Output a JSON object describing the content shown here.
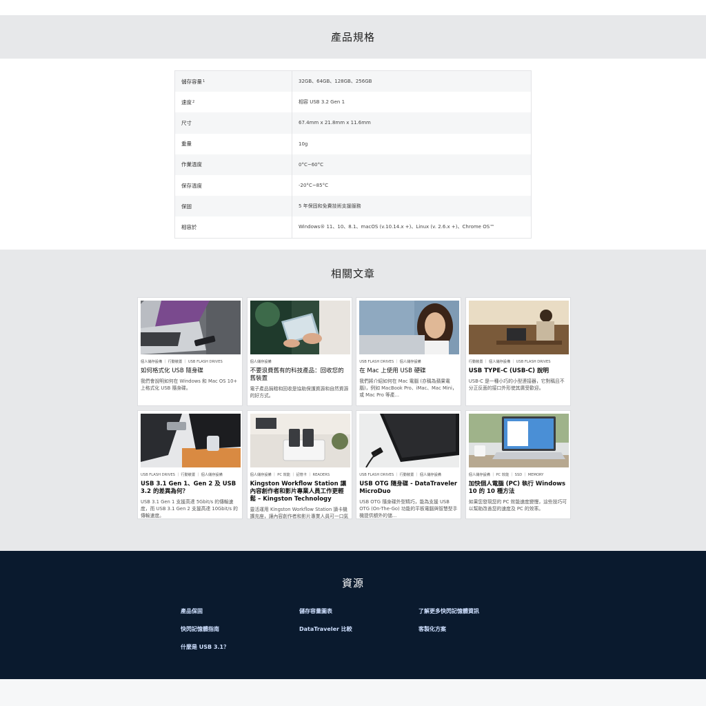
{
  "spec": {
    "title": "產品規格",
    "rows": [
      {
        "label": "儲存容量",
        "sup": "1",
        "value": "32GB、64GB、128GB、256GB"
      },
      {
        "label": "速度",
        "sup": "2",
        "value": "相容 USB 3.2 Gen 1"
      },
      {
        "label": "尺寸",
        "sup": "",
        "value": "67.4mm x 21.8mm x 11.6mm"
      },
      {
        "label": "重量",
        "sup": "",
        "value": "10g"
      },
      {
        "label": "作業溫度",
        "sup": "",
        "value": "0°C~60°C"
      },
      {
        "label": "保存溫度",
        "sup": "",
        "value": "-20°C~85°C"
      },
      {
        "label": "保固",
        "sup": "",
        "value": "5 年保固和免費技術支援服務"
      },
      {
        "label": "相容於",
        "sup": "",
        "value": "Windows® 11、10、8.1、macOS (v.10.14.x +)、Linux (v. 2.6.x +)、Chrome OS™"
      }
    ]
  },
  "articles": {
    "title": "相關文章",
    "cards": [
      {
        "tags": "個人儲存設備 ｜ 行動裝置 ｜ USB FLASH DRIVES",
        "title": "如何格式化 USB 隨身碟",
        "bold": false,
        "desc": "我們會說明如何在 Windows 和 Mac OS 10+ 上格式化 USB 隨身碟。"
      },
      {
        "tags": "個人儲存設備",
        "title": "不要浪費舊有的科技產品：回收您的舊裝置",
        "bold": false,
        "desc": "電子產品捐贈和回收是協助保護資源和自然資源的好方式。"
      },
      {
        "tags": "USB FLASH DRIVES ｜ 個人儲存設備",
        "title": "在 Mac 上使用 USB 硬碟",
        "bold": false,
        "desc": "我們將介紹如何在 Mac 電腦 (亦稱為蘋果電腦)，例如 MacBook Pro、iMac、Mac Mini，或 Mac Pro 等產..."
      },
      {
        "tags": "行動裝置 ｜ 個人儲存設備 ｜ USB FLASH DRIVES",
        "title": "USB TYPE-C (USB-C) 說明",
        "bold": true,
        "desc": "USB-C 是一種小巧的小型連接器，它對稱且不分正反面的接口外形使其廣受歡迎。"
      },
      {
        "tags": "USB FLASH DRIVES ｜ 行動裝置 ｜ 個人儲存設備",
        "title": "USB 3.1 Gen 1、Gen 2 及 USB 3.2 的差異為何？",
        "bold": true,
        "desc": "USB 3.1 Gen 1 支援高達 5Gbit/s 的傳輸速度，而 USB 3.1 Gen 2 支援高達 10Gbit/s 的傳輸速度。"
      },
      {
        "tags": "個人儲存設備 ｜ PC 效能 ｜ 記憶卡 ｜ READERS",
        "title": "Kingston Workflow Station 讓內容創作者和影片專業人員工作更輕鬆 – Kingston Technology",
        "bold": true,
        "desc": "靈活運用 Kingston Workflow Station 讀卡機擴充座，讓內容創作者和影片專業人員可一口氣傳輸多重來..."
      },
      {
        "tags": "USB FLASH DRIVES ｜ 行動裝置 ｜ 個人儲存設備",
        "title": "USB OTG 隨身碟 - DataTraveler MicroDuo",
        "bold": true,
        "desc": "USB OTG 隨身碟外型精巧，能為支援 USB OTG (On-The-Go) 功能的平板電腦與智慧型手機提供額外的儲..."
      },
      {
        "tags": "個人儲存設備 ｜ PC 效能 ｜ SSD ｜ MEMORY",
        "title": "加快個人電腦 (PC) 執行 Windows 10 的 10 種方法",
        "bold": true,
        "desc": "如果您發現您的 PC 效能速度變慢，這些技巧可以幫助改善您的速度及 PC 的效率。"
      }
    ]
  },
  "footer": {
    "title": "資源",
    "links": [
      "產品保固",
      "儲存容量圖表",
      "了解更多快閃記憶體資訊",
      "快閃記憶體指南",
      "DataTraveler 比較",
      "客製化方案",
      "什麼是 USB 3.1？"
    ]
  }
}
